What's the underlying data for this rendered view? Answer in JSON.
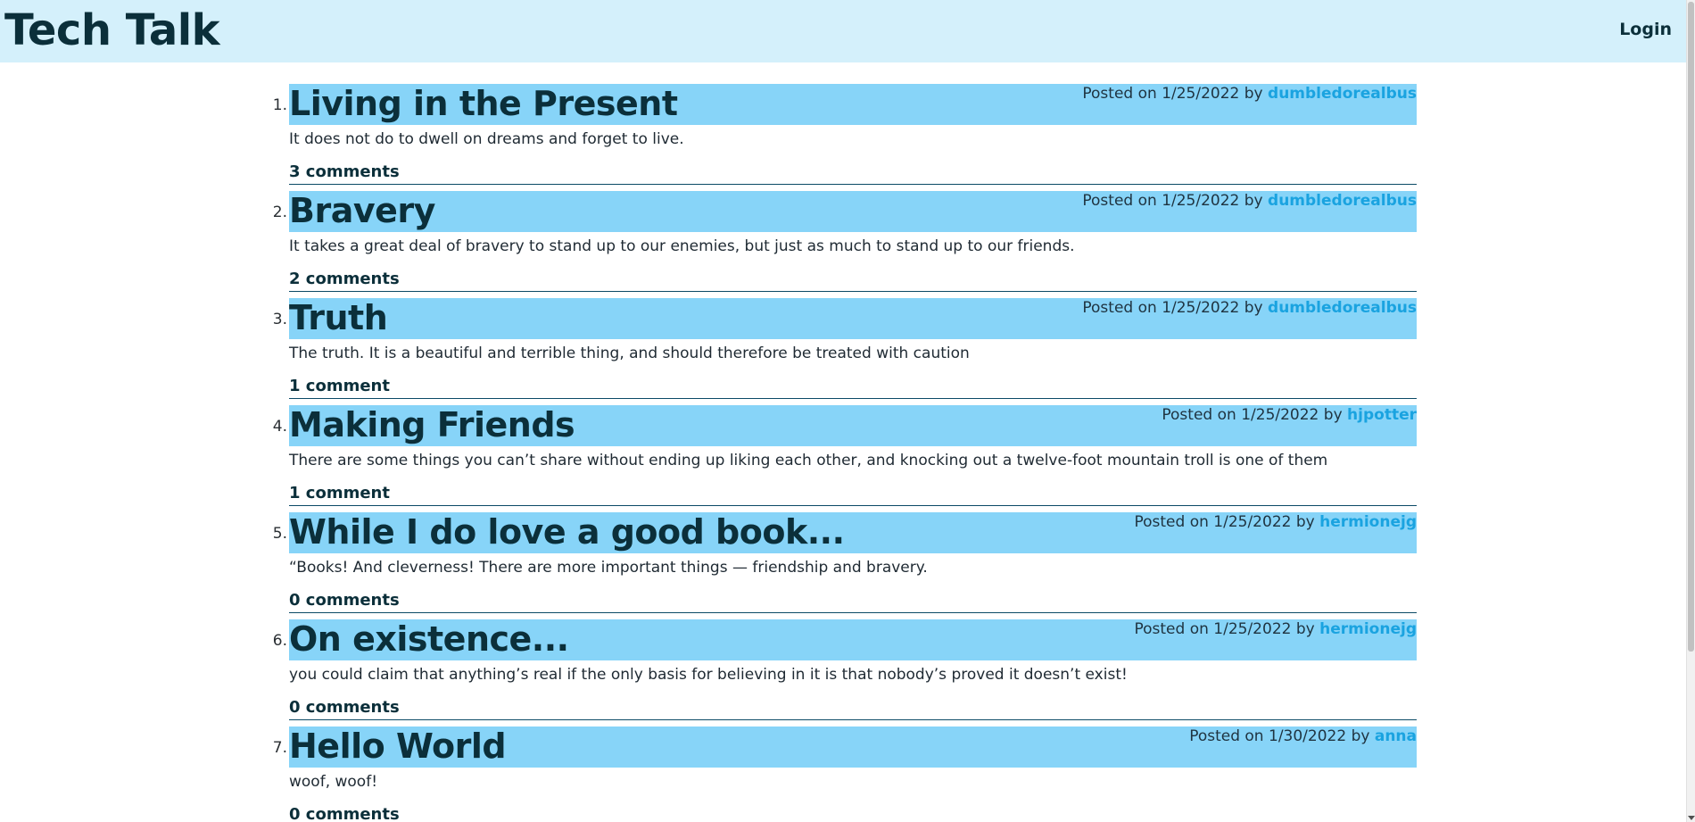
{
  "header": {
    "site_title": "Tech Talk",
    "login_label": "Login",
    "background_color": "#d4f0fb"
  },
  "colors": {
    "post_header_bg": "#87d4f8",
    "author_link": "#1aa3e0",
    "heading_text": "#0b2f3a"
  },
  "meta_prefix": "Posted on",
  "meta_by": "by",
  "posts": [
    {
      "number": "1.",
      "title": "Living in the Present",
      "date": "1/25/2022",
      "author": "dumbledorealbus",
      "body": "It does not do to dwell on dreams and forget to live.",
      "comments": "3 comments"
    },
    {
      "number": "2.",
      "title": "Bravery",
      "date": "1/25/2022",
      "author": "dumbledorealbus",
      "body": "It takes a great deal of bravery to stand up to our enemies, but just as much to stand up to our friends.",
      "comments": "2 comments"
    },
    {
      "number": "3.",
      "title": "Truth",
      "date": "1/25/2022",
      "author": "dumbledorealbus",
      "body": "The truth. It is a beautiful and terrible thing, and should therefore be treated with caution",
      "comments": "1 comment"
    },
    {
      "number": "4.",
      "title": "Making Friends",
      "date": "1/25/2022",
      "author": "hjpotter",
      "body": "There are some things you can’t share without ending up liking each other, and knocking out a twelve-foot mountain troll is one of them",
      "comments": "1 comment"
    },
    {
      "number": "5.",
      "title": "While I do love a good book...",
      "date": "1/25/2022",
      "author": "hermionejg",
      "body": "“Books! And cleverness! There are more important things — friendship and bravery.",
      "comments": "0 comments"
    },
    {
      "number": "6.",
      "title": "On existence...",
      "date": "1/25/2022",
      "author": "hermionejg",
      "body": "you could claim that anything’s real if the only basis for believing in it is that nobody’s proved it doesn’t exist!",
      "comments": "0 comments"
    },
    {
      "number": "7.",
      "title": "Hello World",
      "date": "1/30/2022",
      "author": "anna",
      "body": "woof, woof!",
      "comments": "0 comments"
    }
  ]
}
